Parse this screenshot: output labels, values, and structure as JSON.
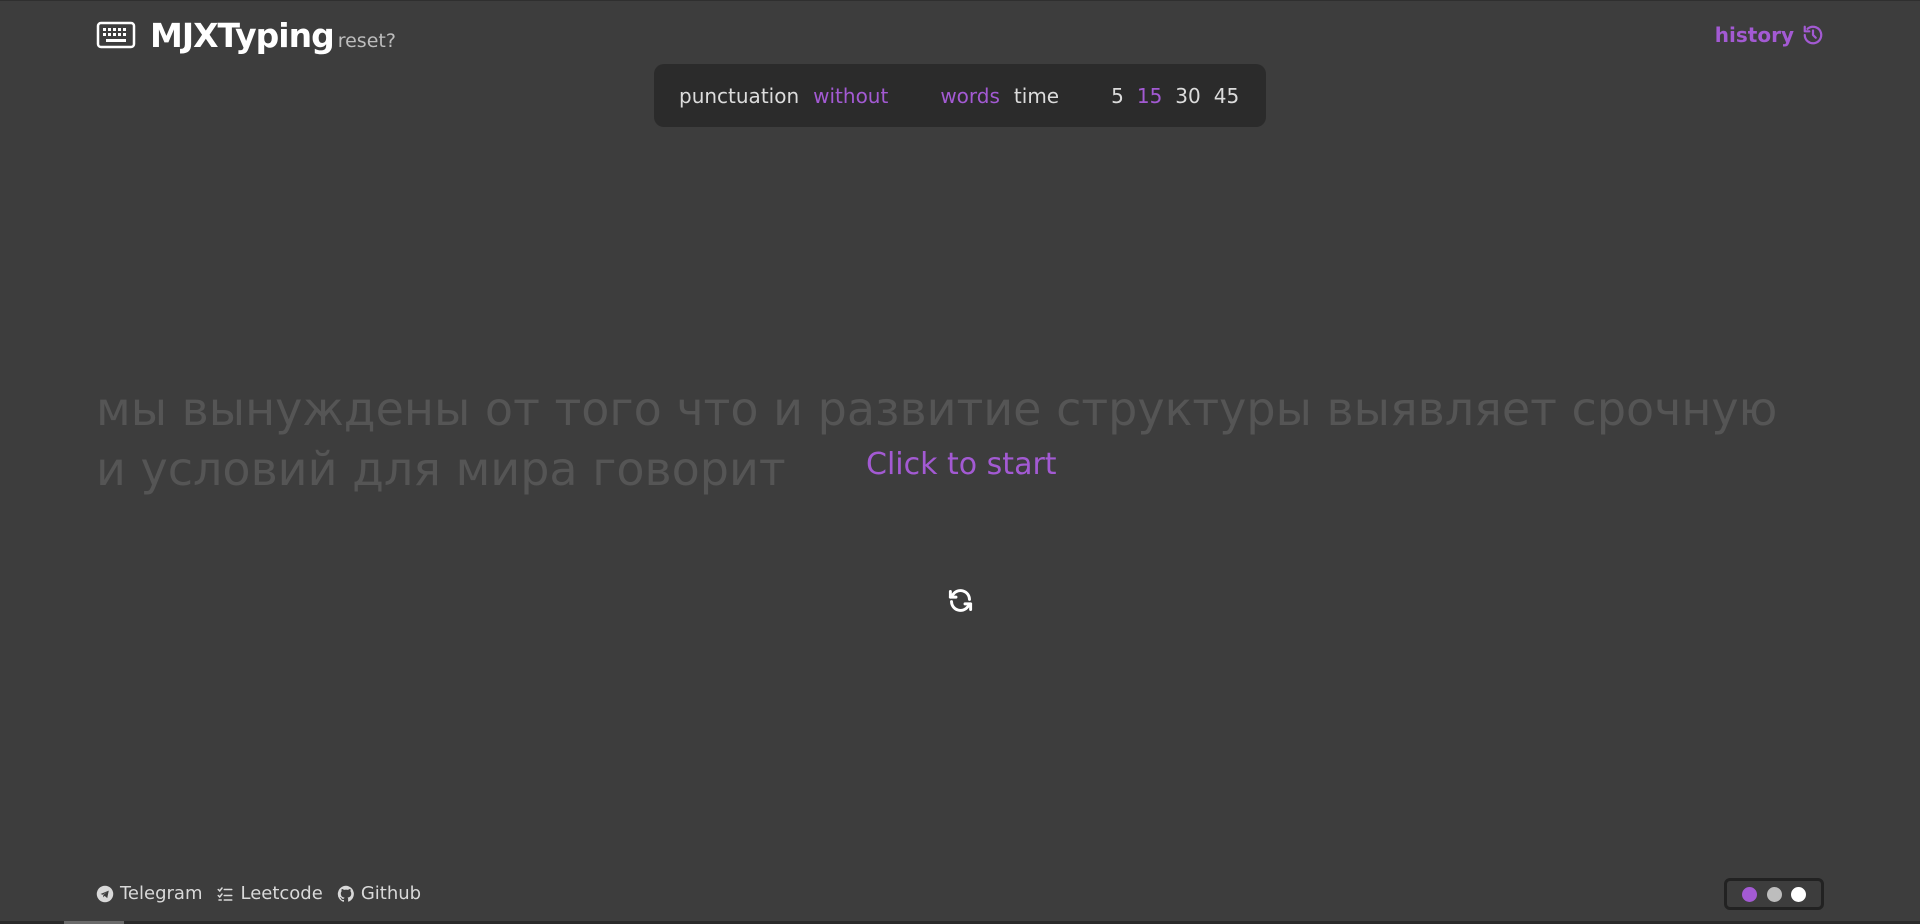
{
  "header": {
    "title": "MJXTyping",
    "reset_label": "reset?",
    "history_label": "history"
  },
  "options": {
    "punctuation_label": "punctuation",
    "punctuation_value": "without",
    "mode_words": "words",
    "mode_time": "time",
    "counts": [
      "5",
      "15",
      "30",
      "45"
    ],
    "selected_count": "15",
    "selected_mode": "words"
  },
  "typing": {
    "text": "мы вынуждены от того что и развитие структуры выявляет срочную и условий для мира говорит",
    "start_prompt": "Click to start"
  },
  "footer": {
    "links": [
      {
        "label": "Telegram",
        "icon": "telegram-icon"
      },
      {
        "label": "Leetcode",
        "icon": "checklist-icon"
      },
      {
        "label": "Github",
        "icon": "github-icon"
      }
    ]
  },
  "themes": {
    "colors": [
      "#a35ad3",
      "#bdbdbd",
      "#ffffff"
    ]
  },
  "colors": {
    "accent": "#a35ad3",
    "background": "#3d3d3d",
    "panel": "#2b2b2b"
  }
}
